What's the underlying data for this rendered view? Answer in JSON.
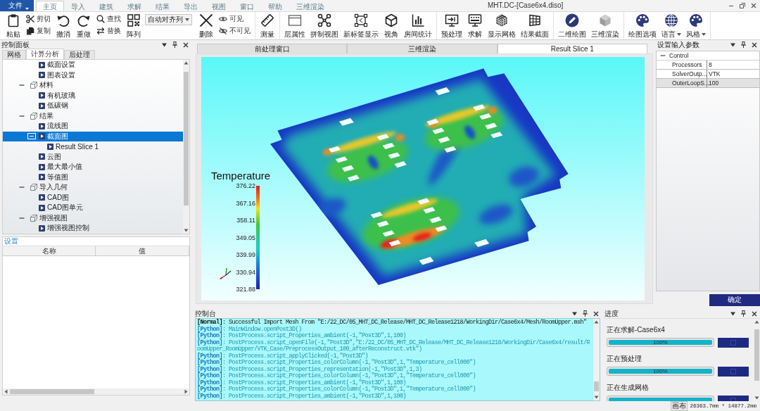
{
  "window": {
    "title": "MHT.DC-[Case6x4.diso]"
  },
  "ribbon": {
    "file_menu": "文件",
    "tabs": [
      {
        "label": "主页",
        "selected": true
      },
      {
        "label": "导入",
        "selected": false
      },
      {
        "label": "建筑",
        "selected": false
      },
      {
        "label": "求解",
        "selected": false
      },
      {
        "label": "结果",
        "selected": false
      },
      {
        "label": "导出",
        "selected": false
      },
      {
        "label": "视图",
        "selected": false
      },
      {
        "label": "窗口",
        "selected": false
      },
      {
        "label": "帮助",
        "selected": false
      },
      {
        "label": "三维渲染",
        "selected": false
      }
    ],
    "groups": [
      {
        "items": [
          {
            "kind": "large",
            "label": "粘贴"
          },
          {
            "kind": "stack",
            "items": [
              {
                "label": "剪切"
              },
              {
                "label": "复制"
              }
            ]
          },
          {
            "kind": "large",
            "label": "撤消"
          },
          {
            "kind": "large",
            "label": "重做"
          },
          {
            "kind": "stack",
            "items": [
              {
                "label": "查找"
              },
              {
                "label": "替换"
              }
            ]
          },
          {
            "kind": "large",
            "label": "阵列"
          },
          {
            "kind": "dropdown",
            "value": "自动对齐列"
          },
          {
            "kind": "large",
            "label": "删除"
          },
          {
            "kind": "stack",
            "items": [
              {
                "label": "可见"
              },
              {
                "label": "不可见"
              }
            ]
          }
        ]
      },
      {
        "items": [
          {
            "kind": "large",
            "label": "测量"
          }
        ]
      },
      {
        "items": [
          {
            "kind": "large",
            "label": "层属性"
          },
          {
            "kind": "large",
            "label": "拼制视图"
          },
          {
            "kind": "large",
            "label": "新标签显示"
          },
          {
            "kind": "large",
            "label": "视角"
          },
          {
            "kind": "large",
            "label": "房间统计"
          }
        ]
      },
      {
        "items": [
          {
            "kind": "large",
            "label": "预处理"
          },
          {
            "kind": "large",
            "label": "求解"
          },
          {
            "kind": "large",
            "label": "显示网格"
          },
          {
            "kind": "large",
            "label": "结果截面"
          }
        ]
      },
      {
        "items": [
          {
            "kind": "large",
            "label": "二维绘图"
          },
          {
            "kind": "large",
            "label": "三维渲染"
          }
        ]
      },
      {
        "items": [
          {
            "kind": "large",
            "label": "绘图选项"
          },
          {
            "kind": "menu",
            "label": "语言"
          },
          {
            "kind": "menu",
            "label": "风格"
          }
        ]
      }
    ]
  },
  "control_panel": {
    "title": "控制面板",
    "tabs": [
      {
        "label": "网格",
        "selected": false
      },
      {
        "label": "计算分析",
        "selected": true
      },
      {
        "label": "后处理",
        "selected": false
      }
    ],
    "tree": [
      {
        "children": [
          {
            "kind": "item",
            "label": "截面设置",
            "selected": false
          },
          {
            "kind": "item",
            "label": "图表设置",
            "selected": false
          }
        ]
      },
      {
        "kind": "group",
        "label": "材料",
        "expanded": true,
        "selected": false,
        "children": [
          {
            "kind": "item",
            "label": "有机玻璃",
            "selected": false
          },
          {
            "kind": "item",
            "label": "低碳钢",
            "selected": false
          }
        ]
      },
      {
        "kind": "group",
        "label": "结果",
        "expanded": true,
        "selected": false,
        "children": [
          {
            "kind": "item",
            "label": "流线图",
            "selected": false
          },
          {
            "kind": "item",
            "label": "截面图",
            "expanded": true,
            "selected": true,
            "children": [
              {
                "kind": "item",
                "label": "Result Slice 1",
                "selected": false
              }
            ]
          },
          {
            "kind": "item",
            "label": "云图",
            "selected": false
          },
          {
            "kind": "item",
            "label": "最大最小值",
            "selected": false
          },
          {
            "kind": "item",
            "label": "等值图",
            "selected": false
          }
        ]
      },
      {
        "kind": "group",
        "label": "导入几何",
        "expanded": true,
        "selected": false,
        "children": [
          {
            "kind": "item",
            "label": "CAD图",
            "selected": false
          },
          {
            "kind": "item",
            "label": "CAD图单元",
            "selected": false
          }
        ]
      },
      {
        "kind": "group",
        "label": "增强视图",
        "expanded": true,
        "selected": false,
        "children": [
          {
            "kind": "item",
            "label": "增强视图控制",
            "selected": false
          }
        ]
      }
    ]
  },
  "settings_panel": {
    "title": "设置",
    "columns": [
      "名称",
      "值"
    ]
  },
  "document_tabs": [
    {
      "label": "前处理窗口",
      "selected": false
    },
    {
      "label": "三维渲染",
      "selected": false
    },
    {
      "label": "Result Slice 1",
      "selected": true
    }
  ],
  "viewport": {
    "legend": {
      "title": "Temperature",
      "ticks": [
        "376.22",
        "367.16",
        "358.11",
        "349.05",
        "339.99",
        "330.94",
        "321.88"
      ]
    }
  },
  "parameters_panel": {
    "title": "设置输入参数",
    "groups": [
      {
        "label": "Control",
        "expanded": true,
        "rows": [
          {
            "name": "Processors",
            "value": "8",
            "selected": false
          },
          {
            "name": "SolverOutp...",
            "value": "VTK",
            "selected": false
          },
          {
            "name": "OuterLoopS...",
            "value": "100",
            "selected": true
          }
        ]
      }
    ],
    "confirm_button": "确定"
  },
  "console": {
    "title": "控制台",
    "lines": [
      {
        "kind": "normal",
        "text": "**[Normal]**: Successful Import Mesh From \"E:/22_DC/05_MHT_DC_Release/MHT_DC_Release1218/WorkingDir/Case6x4/Mesh/RoomUpper.msh\""
      },
      {
        "kind": "python",
        "text": "**[Python]**: MainWindow.openPost3D()"
      },
      {
        "kind": "python",
        "text": "**[Python]**: PostProcess.script_Properties_ambient(-1,\"Post3D\",1,100)"
      },
      {
        "kind": "python",
        "text": "**[Python]**: PostProcess.script_openFile(-1,\"Post3D\",\"E:/22_DC/05_MHT_DC_Release/MHT_DC_Release1218/WorkingDir/Case6x4/result/RoomUpper_RoomUpper/VTK_Case/PreprocessOutput_100_afterReconstruct.vtk\")"
      },
      {
        "kind": "python",
        "text": "**[Python]**: PostProcess.script_applyClicked(-1,\"Post3D\")"
      },
      {
        "kind": "python",
        "text": "**[Python]**: PostProcess.script_Properties_colorColumn(-1,\"Post3D\",1,\"Temperature_cell000\")"
      },
      {
        "kind": "python",
        "text": "**[Python]**: PostProcess.script_Properties_representation(-1,\"Post3D\",1,3)"
      },
      {
        "kind": "python",
        "text": "**[Python]**: PostProcess.script_Properties_colorColumn(-1,\"Post3D\",1,\"Temperature_cell000\")"
      },
      {
        "kind": "python",
        "text": "**[Python]**: PostProcess.script_Properties_ambient(-1,\"Post3D\",1,100)"
      },
      {
        "kind": "python",
        "text": "**[Python]**: PostProcess.script_Properties_colorColumn(-1,\"Post3D\",1,\"Temperature_cell000\")"
      },
      {
        "kind": "python",
        "text": "**[Python]**: PostProcess.script_Properties_ambient(-1,\"Post3D\",1,100)"
      }
    ]
  },
  "progress_panel": {
    "title": "进度",
    "tasks": [
      {
        "label": "正在求解-Case6x4",
        "level": 1,
        "reading": "100%"
      },
      {
        "label": "正在预处理",
        "level": 1,
        "reading": "100%"
      },
      {
        "label": "正在生成网格",
        "level": 1
      }
    ]
  },
  "status_bar": {
    "label": "画布",
    "value": "26363.7mm * 14877.2mm"
  }
}
